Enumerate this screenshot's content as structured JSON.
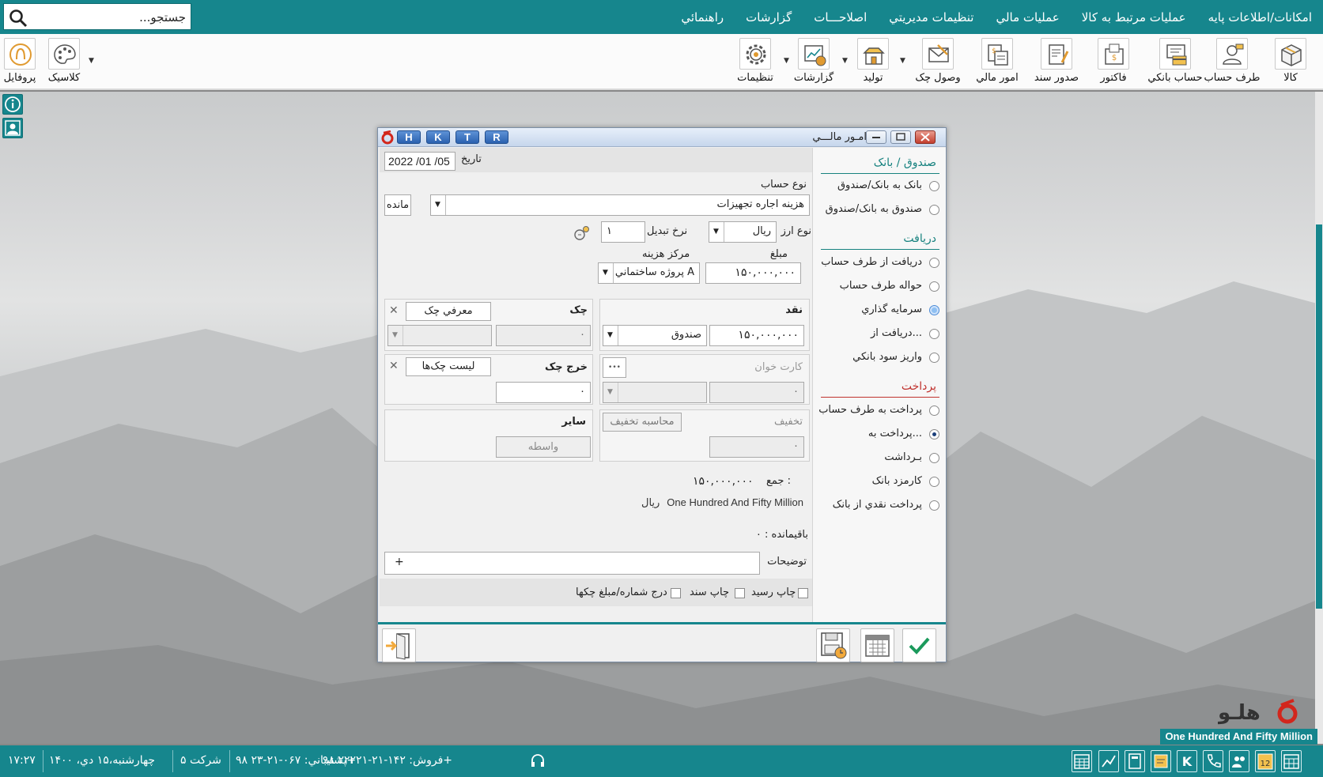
{
  "search": {
    "placeholder": "جستجو..."
  },
  "menu": [
    "امکانات/اطلاعات پايه",
    "عمليات مرتبط به کالا",
    "عمليات مالي",
    "تنظيمات مديريتي",
    "اصلاحـــات",
    "گزارشات",
    "راهنمائي"
  ],
  "toolbar": {
    "kala": "کالا",
    "taraf": "طرف حساب",
    "bank": "حساب بانکي",
    "factor": "فاکتور",
    "sanad": "صدور سند",
    "mali": "امور مالي",
    "check": "وصول چک",
    "tolid": "توليد",
    "report": "گزارشات",
    "settings": "تنظيمات",
    "classic": "کلاسيک",
    "profile": "پروفايل"
  },
  "dialog": {
    "title": "امـور مالـــي",
    "hk_buttons": [
      "H",
      "K",
      "T",
      "R"
    ],
    "sections": {
      "cash_bank": "صندوق / بانک",
      "receive": "دريافت",
      "payment": "پرداخت"
    },
    "options": {
      "bank_to": "بانک به بانک/صندوق",
      "box_to": "صندوق به بانک/صندوق",
      "recv_party": "دريافت از طرف حساب",
      "transfer_party": "حواله طرف حساب",
      "investment": "سرمايه گذاري",
      "recv_from": "دريافت از...",
      "deposit_interest": "واريز سود بانکي",
      "pay_party": "پرداخت به طرف حساب",
      "pay_to": "پرداخت به...",
      "withdraw": "بـرداشت",
      "bank_fee": "کارمزد بانک",
      "cash_from_bank": "پرداخت نقدي از بانک"
    },
    "date_label": "تاريخ",
    "date_value": "2022 /01 /05",
    "account_type_label": "نوع حساب",
    "account_type_value": "هزينه اجاره تجهيزات",
    "balance_button": "مانده",
    "currency_label": "نوع ارز",
    "currency_value": "ريال",
    "rate_label": "نرخ تبديل",
    "rate_value": "۱",
    "amount_label": "مبلغ",
    "amount_value": "۱۵۰,۰۰۰,۰۰۰",
    "cost_center_label": "مرکز هزينه",
    "cost_center_value": "پروژه ساختماني A",
    "cash": {
      "title": "نقد",
      "account": "صندوق",
      "amount": "۱۵۰,۰۰۰,۰۰۰"
    },
    "card": {
      "title": "کارت خوان",
      "more": "•••",
      "amount": "۰"
    },
    "discount": {
      "title": "تخفيف",
      "calc_button": "محاسبه تخفيف",
      "amount": "۰"
    },
    "check_in": {
      "title": "چک",
      "intro_button": "معرفي چک",
      "amount": "۰"
    },
    "check_out": {
      "title": "خرج چک",
      "list_button": "ليست چک‌ها",
      "amount": "۰"
    },
    "other": {
      "title": "ساير",
      "broker_button": "واسطه"
    },
    "total_label": "جمع :",
    "total_value": "۱۵۰,۰۰۰,۰۰۰",
    "words_value": "One Hundred  And Fifty Million",
    "words_unit": "ريال",
    "remaining_label": "باقيمانده : ۰",
    "description_label": "توضيحات",
    "description_plus": "+",
    "print_receipt": "چاپ رسيد",
    "print_doc": "چاپ سند",
    "insert_check_nums": "درج شماره/مبلغ چکها"
  },
  "banner": "One Hundred  And Fifty Million",
  "status": {
    "time": "۱۷:۲۷",
    "date": "چهارشنبه،۱۵ دي، ۱۴۰۰",
    "company": "شرکت ۵",
    "support": "پشتيباني: ۰۶۷-۲۱-۲۳ ۹۸+",
    "sales": "فروش:  ۱۴۲-۲۱-۲۲۲۲۱ ۹۸+",
    "calendar_day": "12"
  },
  "colors": {
    "accent": "#16868d",
    "title_blue": "#2b62b0",
    "payment_red": "#c0322e"
  }
}
